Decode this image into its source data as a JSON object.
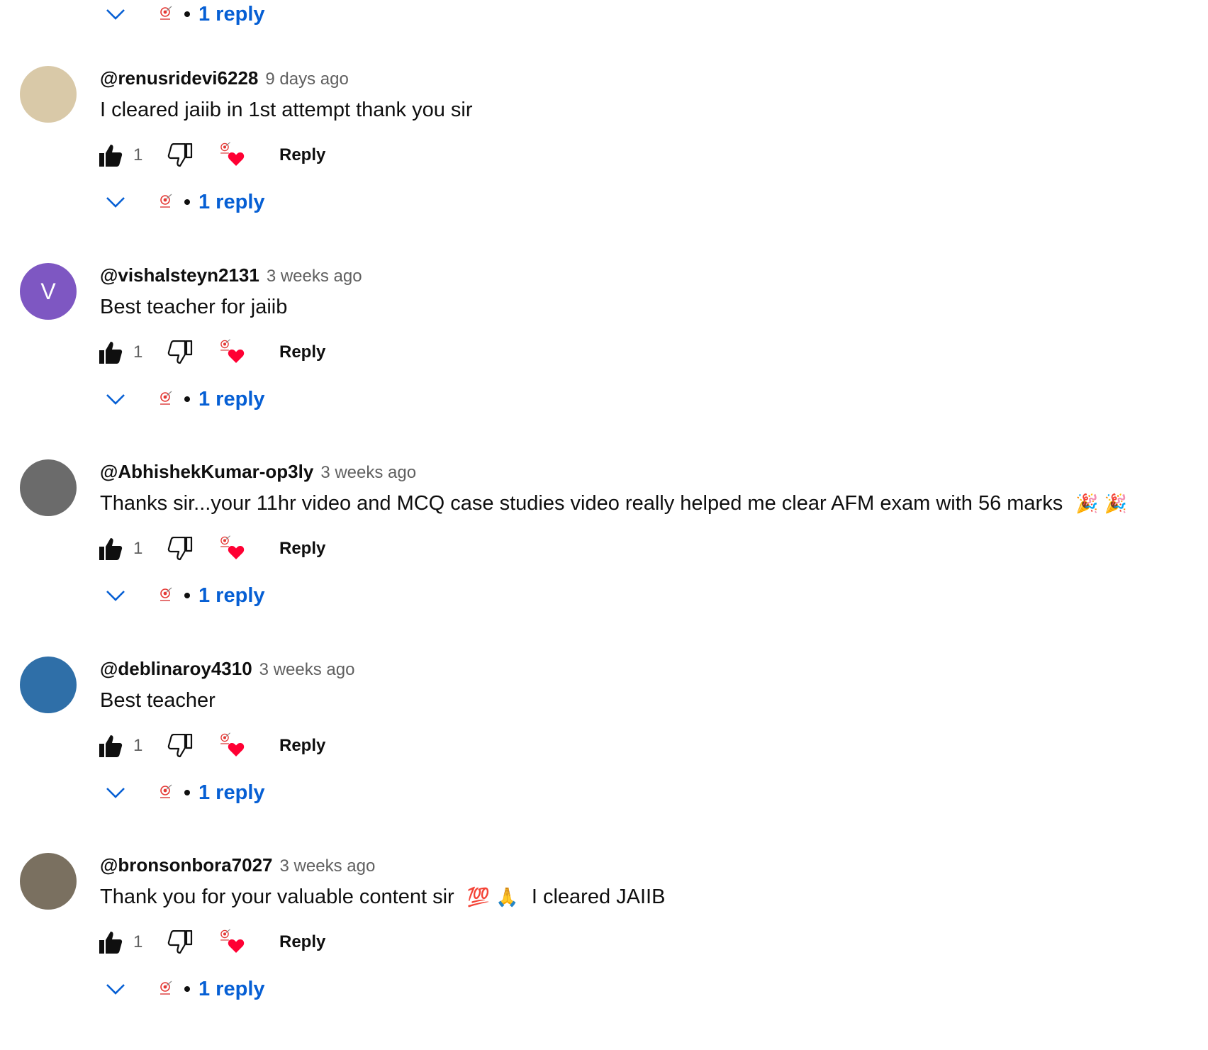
{
  "top_replies": {
    "count_label": "1 reply"
  },
  "comments": [
    {
      "author": "@renusridevi6228",
      "time": "9 days ago",
      "text": "I cleared jaiib in 1st attempt thank you sir",
      "emoji": "",
      "text_after": "",
      "likes": "1",
      "reply_label": "Reply",
      "replies_label": "1 reply",
      "avatar_letter": "",
      "avatar_color": "#d9c9a8"
    },
    {
      "author": "@vishalsteyn2131",
      "time": "3 weeks ago",
      "text": "Best teacher for jaiib",
      "emoji": "",
      "text_after": "",
      "likes": "1",
      "reply_label": "Reply",
      "replies_label": "1 reply",
      "avatar_letter": "V",
      "avatar_color": "#7e57c2"
    },
    {
      "author": "@AbhishekKumar-op3ly",
      "time": "3 weeks ago",
      "text": "Thanks sir...your 11hr  video and MCQ case studies video really helped me clear AFM exam with 56 marks",
      "emoji": "🎉 🎉",
      "text_after": "",
      "likes": "1",
      "reply_label": "Reply",
      "replies_label": "1 reply",
      "avatar_letter": "",
      "avatar_color": "#6b6b6b"
    },
    {
      "author": "@deblinaroy4310",
      "time": "3 weeks ago",
      "text": "Best teacher",
      "emoji": "",
      "text_after": "",
      "likes": "1",
      "reply_label": "Reply",
      "replies_label": "1 reply",
      "avatar_letter": "",
      "avatar_color": "#2f6fa8"
    },
    {
      "author": "@bronsonbora7027",
      "time": "3 weeks ago",
      "text": "Thank you for your valuable content sir",
      "emoji": "💯 🙏",
      "text_after": "I cleared JAIIB",
      "likes": "1",
      "reply_label": "Reply",
      "replies_label": "1 reply",
      "avatar_letter": "",
      "avatar_color": "#7a7060"
    }
  ],
  "colors": {
    "link_blue": "#065fd4",
    "secondary_text": "#606060",
    "heart_red": "#ff0033",
    "creator_logo_red": "#e53935"
  },
  "icons": [
    "chevron-down-icon",
    "like-icon",
    "dislike-icon",
    "creator-heart-icon",
    "creator-avatar-icon"
  ]
}
